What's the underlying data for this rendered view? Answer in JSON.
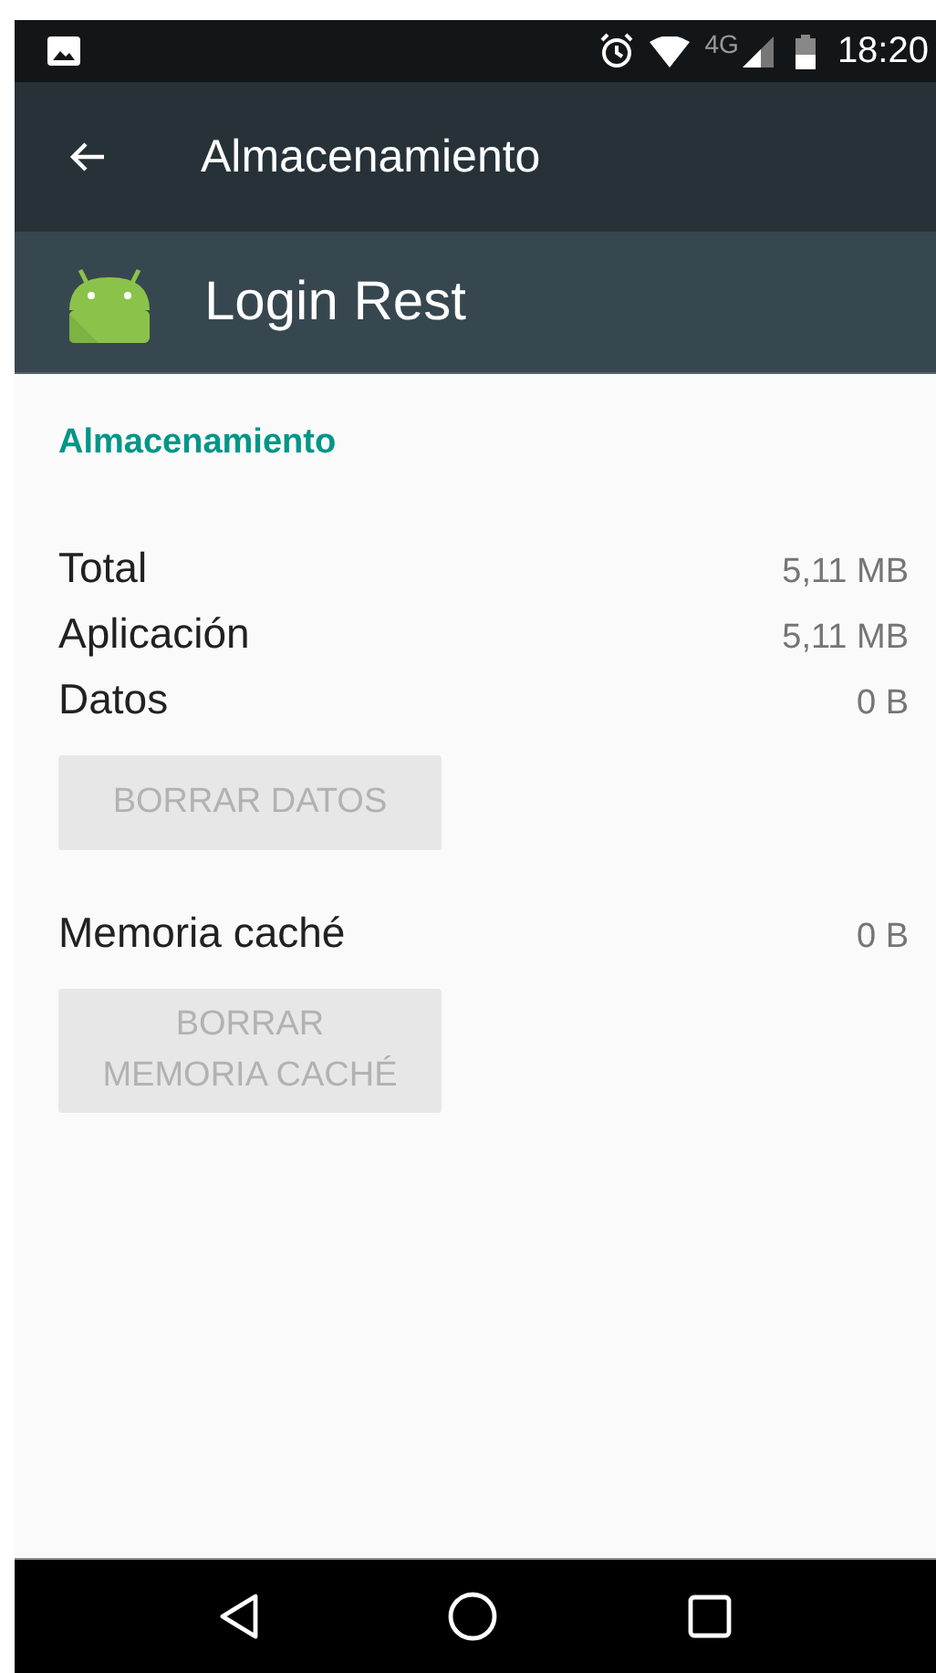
{
  "status_bar": {
    "network": "4G",
    "time": "18:20"
  },
  "toolbar": {
    "title": "Almacenamiento"
  },
  "app_header": {
    "name": "Login Rest"
  },
  "section_title": "Almacenamiento",
  "groups": [
    {
      "rows": [
        {
          "label": "Total",
          "value": "5,11 MB"
        },
        {
          "label": "Aplicación",
          "value": "5,11 MB"
        },
        {
          "label": "Datos",
          "value": "0 B"
        }
      ],
      "button": {
        "lines": [
          "BORRAR DATOS"
        ],
        "disabled": true
      }
    },
    {
      "rows": [
        {
          "label": "Memoria caché",
          "value": "0 B"
        }
      ],
      "button": {
        "lines": [
          "BORRAR",
          "MEMORIA CACHÉ"
        ],
        "disabled": true
      }
    }
  ]
}
